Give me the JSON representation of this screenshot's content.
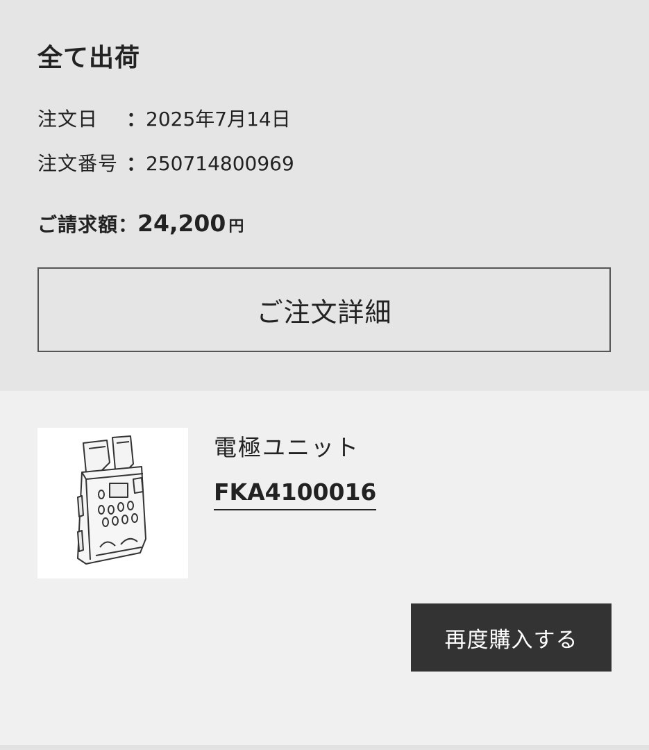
{
  "order": {
    "status": "全て出荷",
    "date_label": "注文日",
    "date_value": "2025年7月14日",
    "number_label": "注文番号",
    "number_value": "250714800969",
    "colon": "：",
    "total_label": "ご請求額",
    "total_amount": "24,200",
    "total_currency": "円",
    "detail_button_label": "ご注文詳細"
  },
  "item": {
    "image_icon": "electrode-unit-part-image",
    "name": "電極ユニット",
    "code": "FKA4100016",
    "rebuy_button_label": "再度購入する"
  },
  "colors": {
    "summary_bg": "#e5e5e5",
    "item_bg": "#f0f0f0",
    "button_dark": "#333333"
  }
}
